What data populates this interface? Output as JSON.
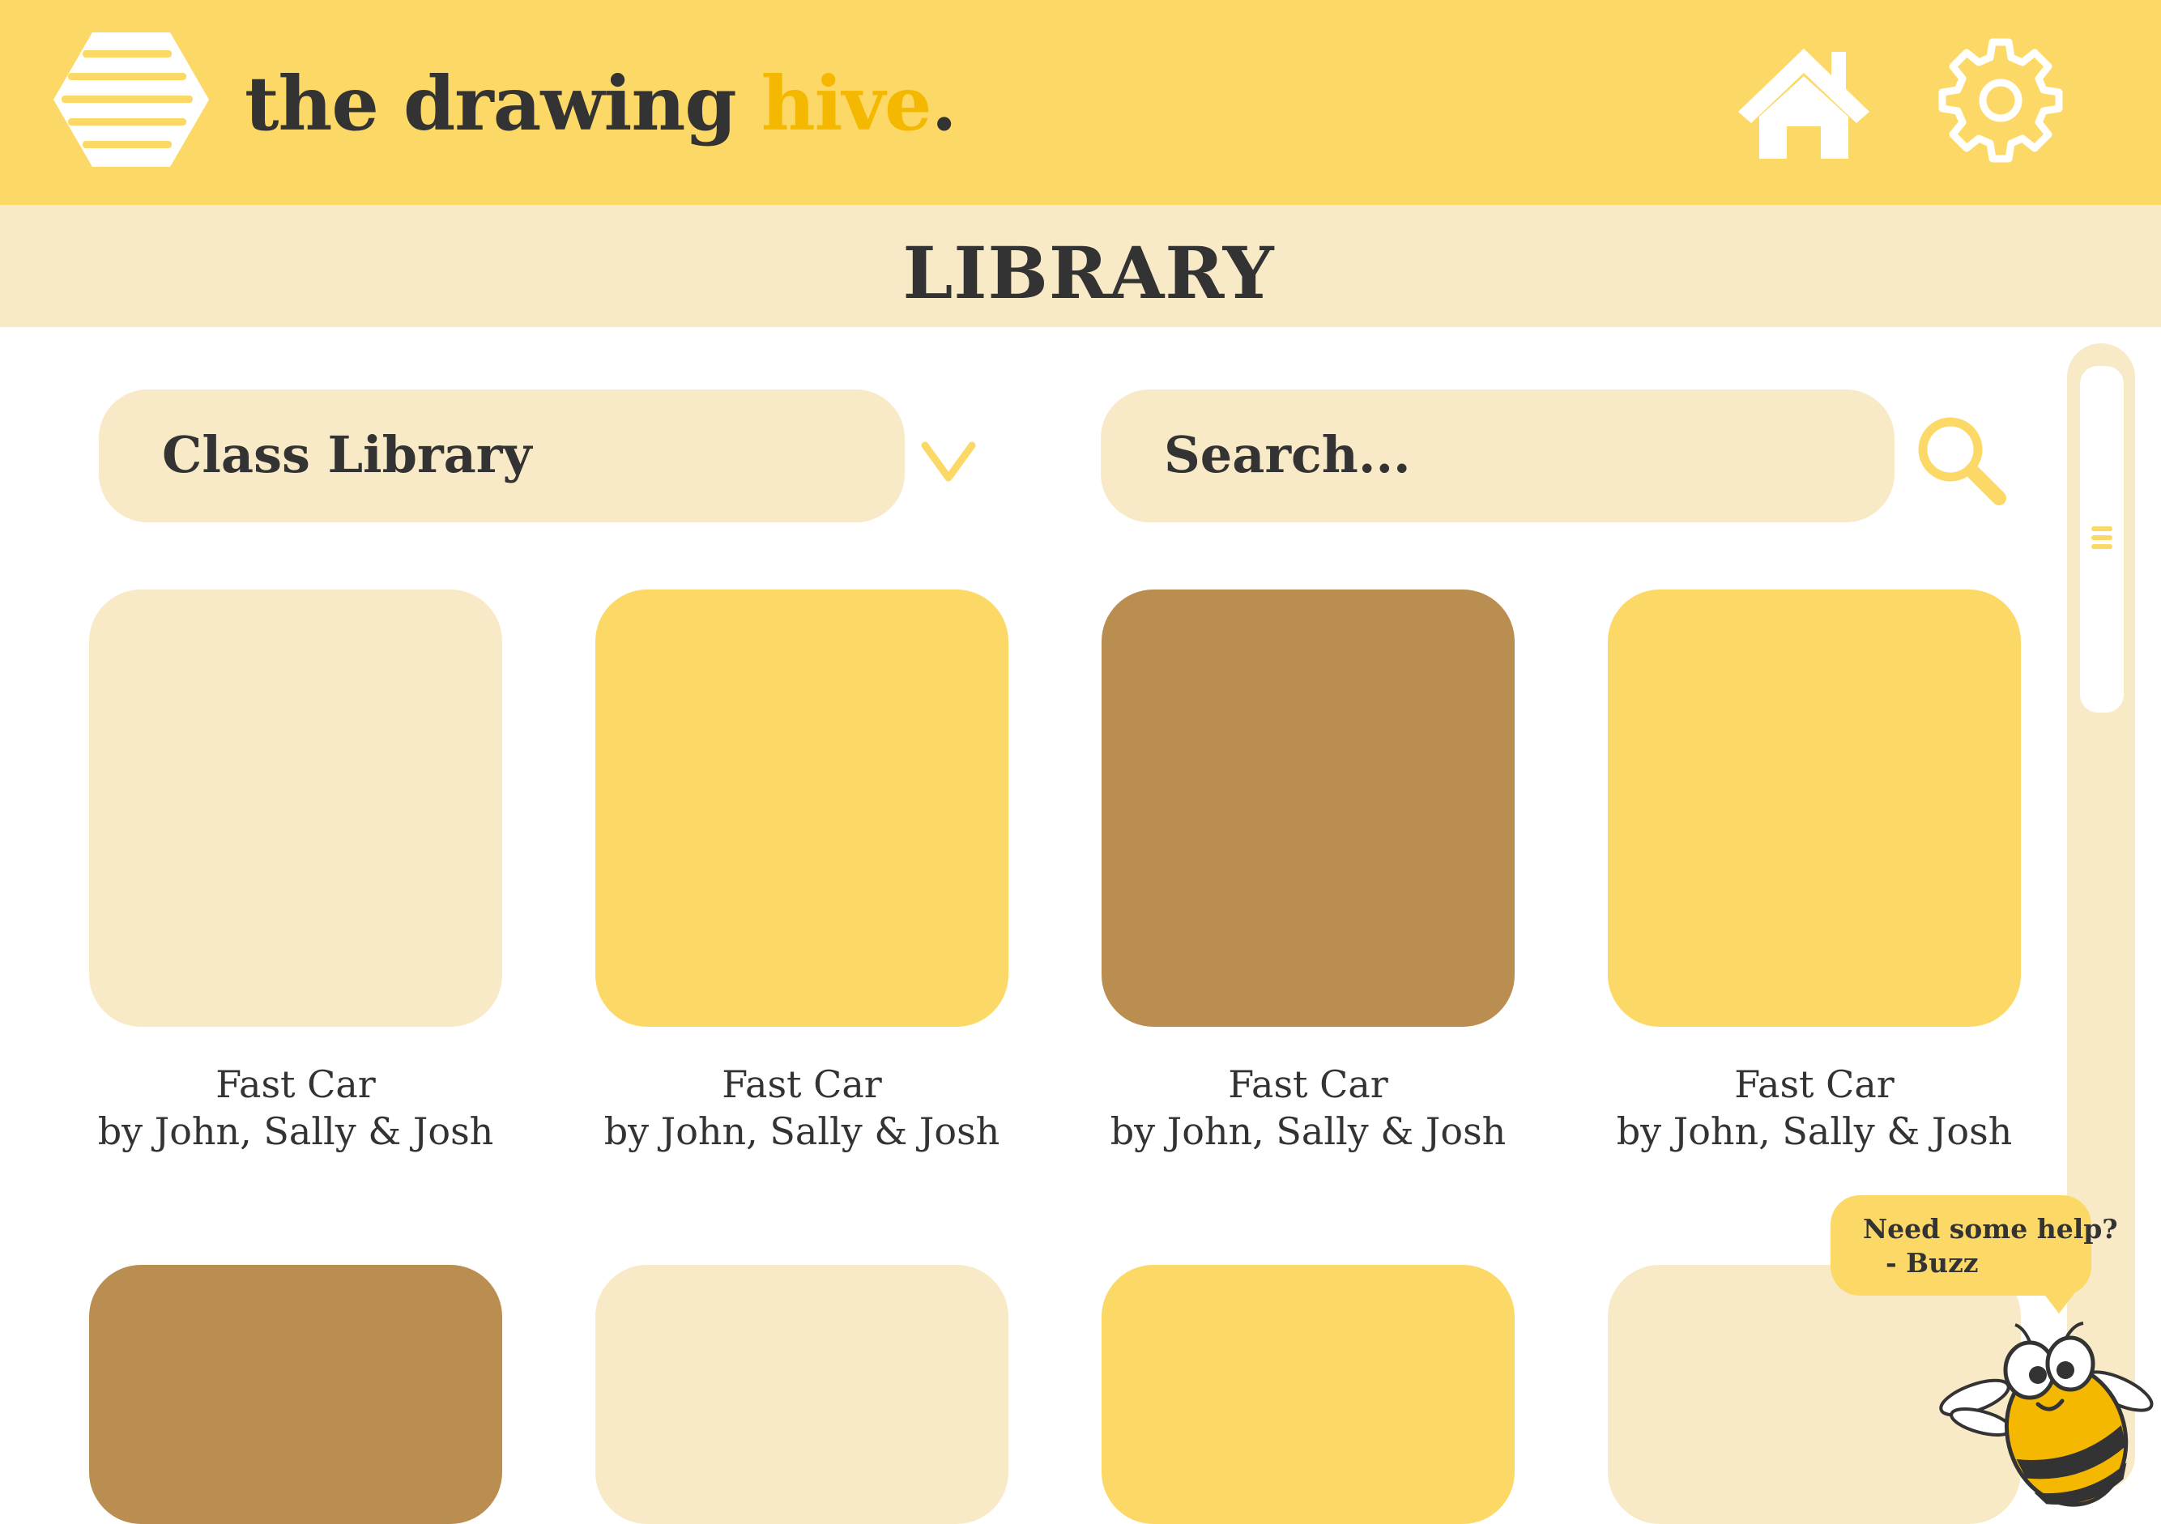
{
  "colors": {
    "header_bg": "#FCD966",
    "accent_text": "#F5B800",
    "light_panel": "#F8EAC6",
    "brown_card": "#BA8E50",
    "text": "#333333"
  },
  "header": {
    "logo_icon": "honeycomb-hexagon-icon",
    "brand_main": "the drawing ",
    "brand_accent": "hive",
    "brand_dot": ".",
    "home_icon": "home-icon",
    "settings_icon": "gear-icon"
  },
  "page": {
    "title": "LIBRARY"
  },
  "filters": {
    "library_selected": "Class Library",
    "dropdown_icon": "chevron-down-icon",
    "search_placeholder": "Search...",
    "search_icon": "search-icon"
  },
  "cards_row1": [
    {
      "title": "Fast Car",
      "authors": "by John, Sally & Josh",
      "color": "#F8EAC6"
    },
    {
      "title": "Fast Car",
      "authors": "by John, Sally & Josh",
      "color": "#FCD966"
    },
    {
      "title": "Fast Car",
      "authors": "by John, Sally & Josh",
      "color": "#BA8E50"
    },
    {
      "title": "Fast Car",
      "authors": "by John, Sally & Josh",
      "color": "#FCD966"
    }
  ],
  "cards_row2": [
    {
      "color": "#BA8E50"
    },
    {
      "color": "#F8EAC6"
    },
    {
      "color": "#FCD966"
    },
    {
      "color": "#F8EAC6"
    }
  ],
  "help": {
    "message": "Need some help?",
    "signature": "- Buzz",
    "mascot_icon": "bee-mascot-icon"
  }
}
